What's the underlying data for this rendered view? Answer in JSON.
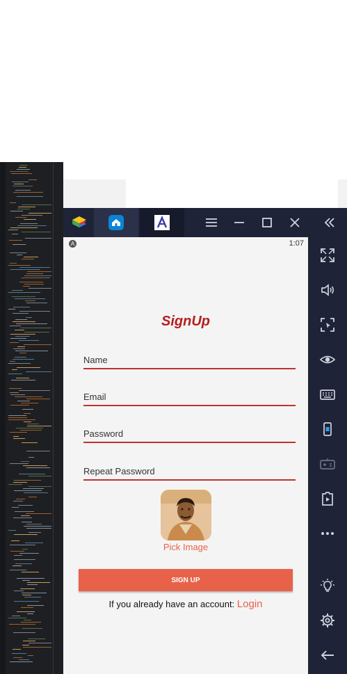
{
  "emulator": {
    "statusbar": {
      "time": "1:07",
      "indicator": "A"
    }
  },
  "app": {
    "title": "SignUp",
    "fields": [
      {
        "label": "Name"
      },
      {
        "label": "Email"
      },
      {
        "label": "Password"
      },
      {
        "label": "Repeat Password"
      }
    ],
    "pick_image_label": "Pick Image",
    "signup_button_label": "SIGN UP",
    "login_prompt": "If you already have an account: ",
    "login_link": "Login"
  },
  "colors": {
    "accent": "#e8624a",
    "title_red": "#b51f1f",
    "underline": "#c0312b",
    "emulator_chrome": "#1f2337",
    "screen_bg": "#f4f4f4"
  },
  "icons": {
    "titlebar": [
      "bluestacks-logo-icon",
      "home-icon",
      "app-instance-icon",
      "menu-icon",
      "minimize-icon",
      "maximize-icon",
      "close-icon",
      "collapse-sidebar-icon"
    ],
    "sidebar": [
      "fullscreen-icon",
      "volume-icon",
      "screenshot-region-icon",
      "eye-icon",
      "keyboard-icon",
      "device-icon",
      "gamepad-icon",
      "media-manager-icon",
      "more-icon",
      "light-icon",
      "settings-icon",
      "back-icon"
    ]
  }
}
